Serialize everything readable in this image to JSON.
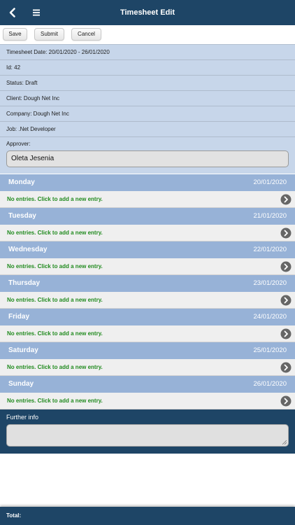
{
  "header": {
    "title": "Timesheet Edit",
    "back_icon": "chevron-left-icon",
    "menu_icon": "hamburger-menu-icon"
  },
  "toolbar": {
    "save_label": "Save",
    "submit_label": "Submit",
    "cancel_label": "Cancel"
  },
  "info": {
    "timesheet_date": "Timesheet Date: 20/01/2020 - 26/01/2020",
    "id": "Id: 42",
    "status": "Status: Draft",
    "client": "Client: Dough Net Inc",
    "company": "Company: Dough Net Inc",
    "job": "Job: .Net Developer",
    "approver_label": "Approver:",
    "approver_value": "Oleta Jesenia"
  },
  "empty_entry_text": "No entries. Click to add a new entry.",
  "days": [
    {
      "name": "Monday",
      "date": "20/01/2020"
    },
    {
      "name": "Tuesday",
      "date": "21/01/2020"
    },
    {
      "name": "Wednesday",
      "date": "22/01/2020"
    },
    {
      "name": "Thursday",
      "date": "23/01/2020"
    },
    {
      "name": "Friday",
      "date": "24/01/2020"
    },
    {
      "name": "Saturday",
      "date": "25/01/2020"
    },
    {
      "name": "Sunday",
      "date": "26/01/2020"
    }
  ],
  "further_info": {
    "label": "Further info",
    "value": ""
  },
  "footer": {
    "total_label": "Total:"
  },
  "colors": {
    "navbar": "#1e4566",
    "info_background": "#c7d6ea",
    "day_header": "#97b2d7",
    "entry_text": "#208a1e"
  }
}
